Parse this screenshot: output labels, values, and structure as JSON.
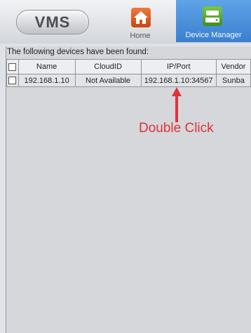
{
  "header": {
    "logo": "VMS",
    "nav": [
      {
        "label": "Home",
        "icon": "home-icon"
      },
      {
        "label": "Device Manager",
        "icon": "device-manager-icon",
        "active": true
      }
    ]
  },
  "device_list": {
    "caption": "The following devices have been found:",
    "columns": [
      "Name",
      "CloudID",
      "IP/Port",
      "Vendor"
    ],
    "rows": [
      {
        "name": "192.168.1.10",
        "cloud_id": "Not Available",
        "ip_port": "192.168.1.10:34567",
        "vendor": "Sunba"
      }
    ]
  },
  "annotation": {
    "text": "Double Click",
    "color": "#e0323a"
  }
}
